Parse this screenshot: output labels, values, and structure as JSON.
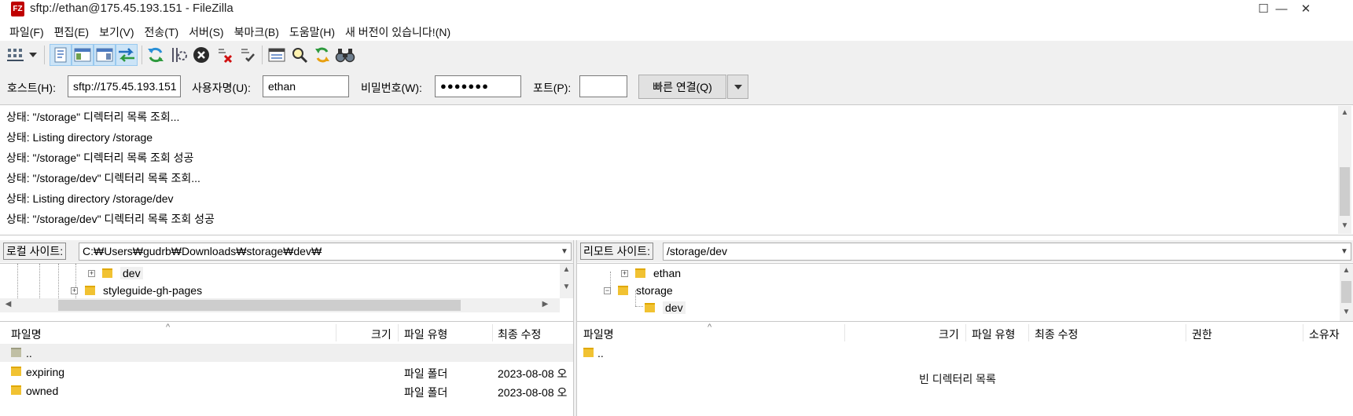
{
  "window": {
    "title": "sftp://ethan@175.45.193.151 - FileZilla",
    "logo_text": "FZ",
    "controls": {
      "minimize": "—",
      "maximize": "☐",
      "close": "✕"
    }
  },
  "menu": [
    "파일(F)",
    "편집(E)",
    "보기(V)",
    "전송(T)",
    "서버(S)",
    "북마크(B)",
    "도움말(H)",
    "새 버전이 있습니다!(N)"
  ],
  "quickconnect": {
    "host_label": "호스트(H):",
    "host_value": "sftp://175.45.193.151",
    "user_label": "사용자명(U):",
    "user_value": "ethan",
    "pass_label": "비밀번호(W):",
    "pass_value": "●●●●●●●",
    "port_label": "포트(P):",
    "port_value": "",
    "connect_label": "빠른 연결(Q)"
  },
  "log": [
    {
      "prefix": "상태:",
      "text": "\"/storage\" 디렉터리 목록 조회..."
    },
    {
      "prefix": "상태:",
      "text": "Listing directory /storage"
    },
    {
      "prefix": "상태:",
      "text": "\"/storage\" 디렉터리 목록 조회 성공"
    },
    {
      "prefix": "상태:",
      "text": "\"/storage/dev\" 디렉터리 목록 조회..."
    },
    {
      "prefix": "상태:",
      "text": "Listing directory /storage/dev"
    },
    {
      "prefix": "상태:",
      "text": "\"/storage/dev\" 디렉터리 목록 조회 성공"
    }
  ],
  "local": {
    "site_label": "로컬 사이트:",
    "path": "C:₩Users₩gudrb₩Downloads₩storage₩dev₩",
    "tree": [
      {
        "label": "dev"
      },
      {
        "label": "styleguide-gh-pages"
      }
    ],
    "columns": {
      "name": "파일명",
      "size": "크기",
      "type": "파일 유형",
      "modified": "최종 수정"
    },
    "files": [
      {
        "name": "..",
        "type": "",
        "modified": ""
      },
      {
        "name": "expiring",
        "type": "파일 폴더",
        "modified": "2023-08-08 오"
      },
      {
        "name": "owned",
        "type": "파일 폴더",
        "modified": "2023-08-08 오"
      }
    ]
  },
  "remote": {
    "site_label": "리모트 사이트:",
    "path": "/storage/dev",
    "tree": [
      {
        "label": "ethan"
      },
      {
        "label": "storage"
      },
      {
        "label": "dev"
      }
    ],
    "columns": {
      "name": "파일명",
      "size": "크기",
      "type": "파일 유형",
      "modified": "최종 수정",
      "perms": "권한",
      "owner": "소유자"
    },
    "files": [
      {
        "name": ".."
      }
    ],
    "empty_message": "빈 디렉터리 목록"
  },
  "icons": {
    "toolbar": [
      "site-manager-icon",
      "dropdown-arrow-icon",
      "message-log-toggle-icon",
      "local-tree-toggle-icon",
      "remote-tree-toggle-icon",
      "transfer-queue-toggle-icon",
      "refresh-icon",
      "process-queue-icon",
      "cancel-icon",
      "disconnect-icon",
      "reconnect-icon",
      "directory-filter-icon",
      "compare-directories-icon",
      "sync-browsing-icon",
      "search-remote-files-icon"
    ]
  },
  "colors": {
    "logo": "#bf0000",
    "folder": "#f1c232",
    "toolbar_bg": "#f0f0f0",
    "active_toggle": "#cce4f7"
  }
}
